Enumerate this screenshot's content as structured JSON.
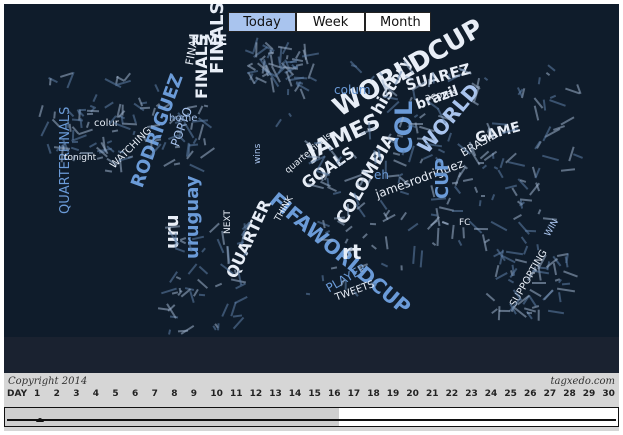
{
  "tabs": [
    {
      "label": "Today",
      "active": true
    },
    {
      "label": "Week",
      "active": false
    },
    {
      "label": "Month",
      "active": false
    }
  ],
  "footer": {
    "copyright": "Copyright 2014",
    "brand": "tagxedo.com",
    "day_label": "DAY",
    "days": [
      "1",
      "2",
      "3",
      "4",
      "5",
      "6",
      "7",
      "8",
      "9",
      "10",
      "11",
      "12",
      "13",
      "14",
      "15",
      "16",
      "17",
      "18",
      "19",
      "20",
      "21",
      "22",
      "23",
      "24",
      "25",
      "26",
      "27",
      "28",
      "29",
      "30"
    ],
    "slider_day": 1,
    "played_until_day": 16
  },
  "map_words": [
    "TIME",
    "FINALS",
    "QUARTERFINALS",
    "FINALS",
    "RODRIGUEZ",
    "JAMES",
    "WORLDCUP",
    "history",
    "brazil",
    "SUAREZ",
    "GAME",
    "BRASIL",
    "COL",
    "WORLD",
    "GOALS",
    "COLOMBIA",
    "jamesrodriguez",
    "FIFAWORLDCUP",
    "CUP",
    "rt",
    "uru",
    "QUARTER",
    "uruguay",
    "PLAYER",
    "home",
    "colum",
    "acores",
    "eh",
    "PORTO",
    "WATCHING",
    "SUPPORTING",
    "FC",
    "THINK",
    "FINAL",
    "colur",
    "quarterfinals",
    "TWEETS",
    "wins",
    "NEXT",
    "WIN",
    "tonight"
  ],
  "colors": {
    "map_bg": "#0f1c2b",
    "word_white": "#e8eef7",
    "word_blue": "#6b9bd8",
    "word_light": "#a9c4ee",
    "tab_active": "#a9c4ee"
  }
}
